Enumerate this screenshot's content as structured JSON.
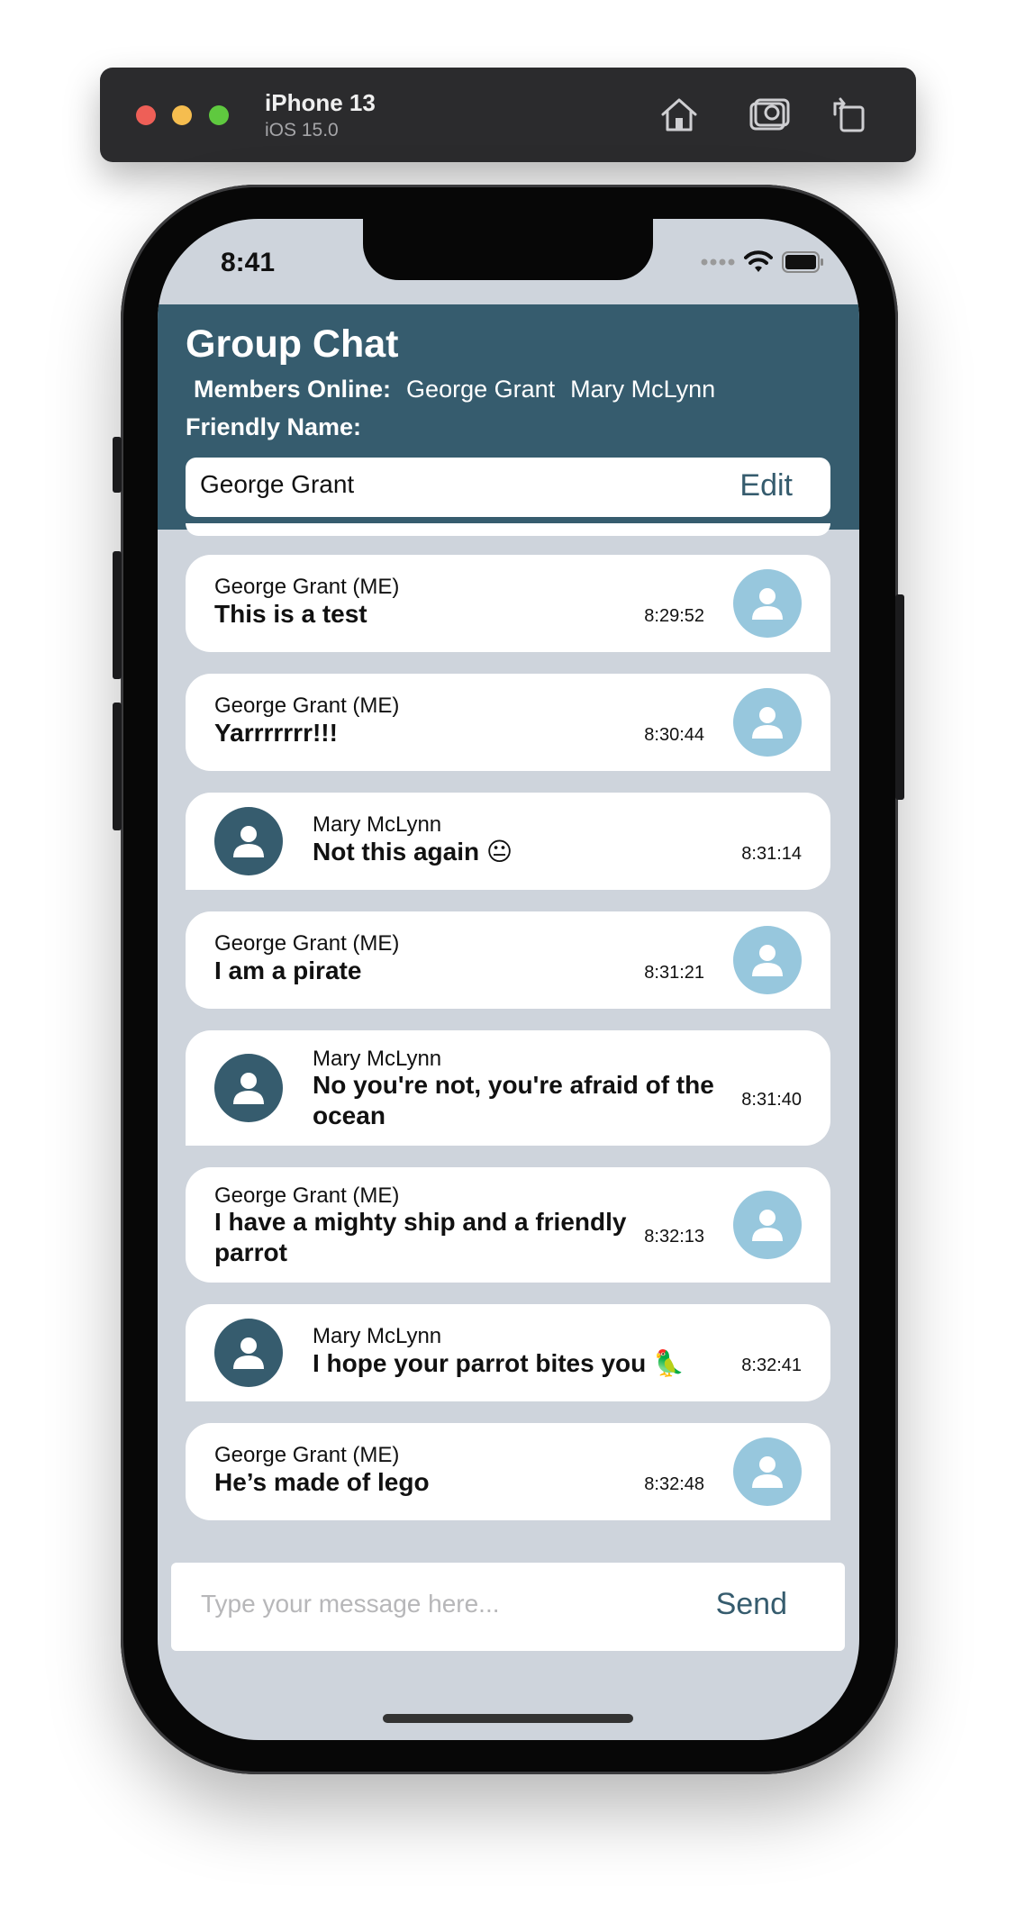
{
  "simulator": {
    "device": "iPhone 13",
    "os": "iOS 15.0"
  },
  "status_bar": {
    "time": "8:41"
  },
  "header": {
    "title": "Group Chat",
    "members_label": "Members Online:",
    "members": [
      "George Grant",
      "Mary McLynn"
    ],
    "friendly_label": "Friendly Name:",
    "friendly_value": "George Grant",
    "edit_label": "Edit"
  },
  "messages": [
    {
      "sender": "George Grant (ME)",
      "text": "This is a test",
      "time": "8:29:52",
      "mine": true
    },
    {
      "sender": "George Grant (ME)",
      "text": "Yarrrrrrr!!!",
      "time": "8:30:44",
      "mine": true
    },
    {
      "sender": "Mary McLynn",
      "text": "Not this again 😐",
      "time": "8:31:14",
      "mine": false
    },
    {
      "sender": "George Grant (ME)",
      "text": "I am a pirate",
      "time": "8:31:21",
      "mine": true
    },
    {
      "sender": "Mary McLynn",
      "text": "No you're not, you're afraid of the ocean",
      "time": "8:31:40",
      "mine": false
    },
    {
      "sender": "George Grant (ME)",
      "text": "I have a mighty ship and a friendly parrot",
      "time": "8:32:13",
      "mine": true
    },
    {
      "sender": "Mary McLynn",
      "text": "I hope your parrot bites you 🦜",
      "time": "8:32:41",
      "mine": false
    },
    {
      "sender": "George Grant (ME)",
      "text": "He’s made of lego",
      "time": "8:32:48",
      "mine": true
    }
  ],
  "composer": {
    "placeholder": "Type your message here...",
    "send_label": "Send"
  },
  "colors": {
    "header": "#365c6e",
    "background": "#ced4dc",
    "my_avatar": "#97c7dd",
    "their_avatar": "#365c6e"
  }
}
